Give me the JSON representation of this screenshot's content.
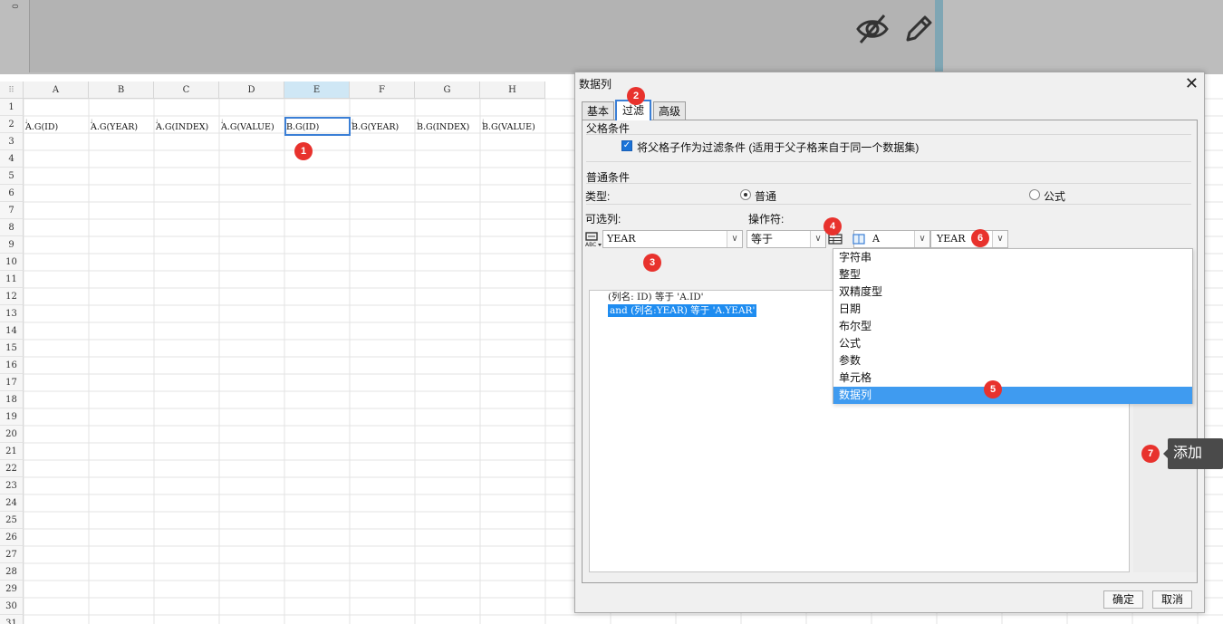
{
  "preview": {
    "ruler_mark": "0"
  },
  "sheet": {
    "columns": [
      "A",
      "B",
      "C",
      "D",
      "E",
      "F",
      "G",
      "H"
    ],
    "selected_column": "E",
    "rows": [
      "1",
      "2",
      "3",
      "4",
      "5",
      "6",
      "7",
      "8",
      "9",
      "10",
      "11",
      "12",
      "13",
      "14",
      "15",
      "16",
      "17",
      "18",
      "19",
      "20",
      "21",
      "22",
      "23",
      "24",
      "25",
      "26",
      "27",
      "28",
      "29",
      "30",
      "31"
    ],
    "row2_cells": [
      "A.G(ID)",
      "A.G(YEAR)",
      "A.G(INDEX)",
      "A.G(VALUE)",
      "B.G(ID)",
      "B.G(YEAR)",
      "B.G(INDEX)",
      "B.G(VALUE)"
    ],
    "selected_cell": "B.G(ID)"
  },
  "badges": [
    "1",
    "2",
    "3",
    "4",
    "5",
    "6",
    "7"
  ],
  "dialog": {
    "title": "数据列",
    "tabs": [
      "基本",
      "过滤",
      "高级"
    ],
    "active_tab": "过滤",
    "parent_section": "父格条件",
    "parent_checkbox_label": "将父格子作为过滤条件 (适用于父子格来自于同一个数据集)",
    "normal_section": "普通条件",
    "type_label": "类型:",
    "type_options": [
      "普通",
      "公式"
    ],
    "type_selected": "普通",
    "optional_column_label": "可选列:",
    "operator_label": "操作符:",
    "column_value": "YEAR",
    "operator_value": "等于",
    "value_type_value": "A",
    "value_field_value": "YEAR",
    "conditions": [
      "(列名: ID) 等于 'A.ID'",
      "and (列名:YEAR) 等于 'A.YEAR'"
    ],
    "value_type_options": [
      "字符串",
      "整型",
      "双精度型",
      "日期",
      "布尔型",
      "公式",
      "参数",
      "单元格",
      "数据列"
    ],
    "value_type_highlight": "数据列",
    "tooltip": "添加",
    "ok_button": "确定",
    "cancel_button": "取消"
  },
  "colors": {
    "accent": "#3b7fd6",
    "badge": "#e8322d",
    "highlight": "#3f9bf0"
  }
}
